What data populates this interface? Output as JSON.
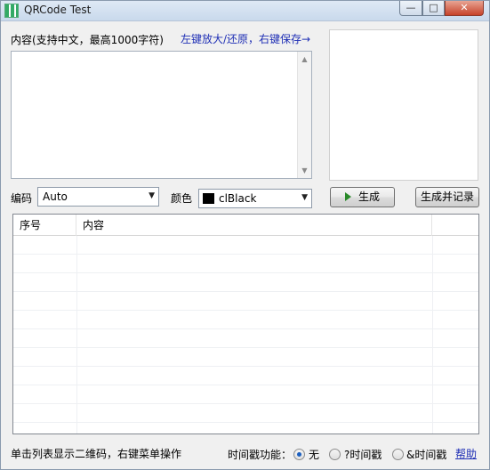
{
  "window": {
    "title": "QRCode Test",
    "minimize": "—",
    "maximize": "□",
    "close": "✕"
  },
  "content": {
    "label": "内容(支持中文，最高1000字符)",
    "hint": "左键放大/还原，右键保存→",
    "text": ""
  },
  "encoding": {
    "label": "编码",
    "value": "Auto"
  },
  "color": {
    "label": "颜色",
    "value": "clBlack",
    "swatch": "#000000"
  },
  "buttons": {
    "generate": "生成",
    "generate_record": "生成并记录"
  },
  "table": {
    "columns": [
      "序号",
      "内容",
      ""
    ],
    "rows": []
  },
  "status": {
    "hint": "单击列表显示二维码，右键菜单操作",
    "timestamp_label": "时间戳功能：",
    "options": [
      "无",
      "?时间戳",
      "&时间戳"
    ],
    "selected": "无",
    "help": "帮助"
  }
}
